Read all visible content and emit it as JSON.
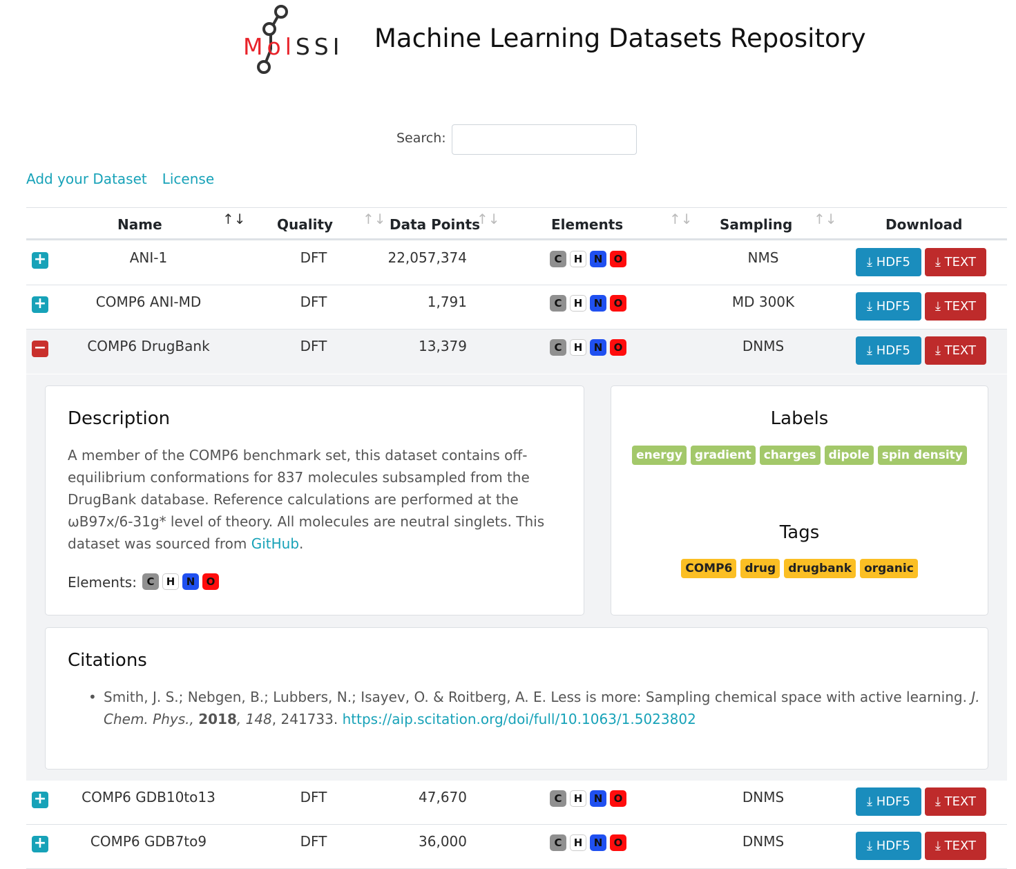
{
  "header": {
    "logo_text": {
      "m": "M",
      "o": "o",
      "l": "l",
      "rest": "SSI"
    },
    "title": "Machine Learning Datasets Repository"
  },
  "search": {
    "label": "Search:",
    "value": "",
    "placeholder": ""
  },
  "links": {
    "add_dataset": "Add your Dataset",
    "license": "License"
  },
  "table": {
    "columns": {
      "name": "Name",
      "quality": "Quality",
      "data_points": "Data Points",
      "elements": "Elements",
      "sampling": "Sampling",
      "download": "Download"
    },
    "sort_glyphs": {
      "active": "↑↓",
      "inactive": "↑↓"
    },
    "element_labels": {
      "c": "C",
      "h": "H",
      "n": "N",
      "o": "O"
    },
    "buttons": {
      "hdf5": "HDF5",
      "text": "TEXT",
      "download_icon": "⤓"
    },
    "toggles": {
      "plus": "+",
      "minus": "−"
    },
    "rows": [
      {
        "name": "ANI-1",
        "quality": "DFT",
        "data_points": "22,057,374",
        "sampling": "NMS",
        "expanded": false
      },
      {
        "name": "COMP6 ANI-MD",
        "quality": "DFT",
        "data_points": "1,791",
        "sampling": "MD 300K",
        "expanded": false
      },
      {
        "name": "COMP6 DrugBank",
        "quality": "DFT",
        "data_points": "13,379",
        "sampling": "DNMS",
        "expanded": true
      },
      {
        "name": "COMP6 GDB10to13",
        "quality": "DFT",
        "data_points": "47,670",
        "sampling": "DNMS",
        "expanded": false
      },
      {
        "name": "COMP6 GDB7to9",
        "quality": "DFT",
        "data_points": "36,000",
        "sampling": "DNMS",
        "expanded": false
      }
    ]
  },
  "detail": {
    "description_heading": "Description",
    "description_text": "A member of the COMP6 benchmark set, this dataset contains off-equilibrium conformations for 837 molecules subsampled from the DrugBank database. Reference calculations are performed at the ωB97x/6-31g* level of theory. All molecules are neutral singlets. This dataset was sourced from ",
    "description_link": "GitHub",
    "description_end": ".",
    "elements_label": "Elements:",
    "labels_heading": "Labels",
    "labels": [
      "energy",
      "gradient",
      "charges",
      "dipole",
      "spin density"
    ],
    "tags_heading": "Tags",
    "tags": [
      "COMP6",
      "drug",
      "drugbank",
      "organic"
    ],
    "citations_heading": "Citations",
    "citation": {
      "bullet": "•",
      "authors": "Smith, J. S.; Nebgen, B.; Lubbers, N.; Isayev, O. & Roitberg, A. E. Less is more: Sampling chemical space with active learning. ",
      "journal": "J. Chem. Phys.,",
      "year": "2018",
      "volume": "148",
      "pages": ", 241733. ",
      "url": "https://aip.scitation.org/doi/full/10.1063/1.5023802"
    }
  },
  "colors": {
    "link": "#17a2b8",
    "hdf5_button": "#1a8dbd",
    "text_button": "#be2b2b",
    "label_badge": "#a3c86a",
    "tag_badge": "#fbbf24",
    "carbon": "#909090",
    "hydrogen": "#ffffff",
    "nitrogen": "#2050f0",
    "oxygen": "#ff0d0d"
  }
}
